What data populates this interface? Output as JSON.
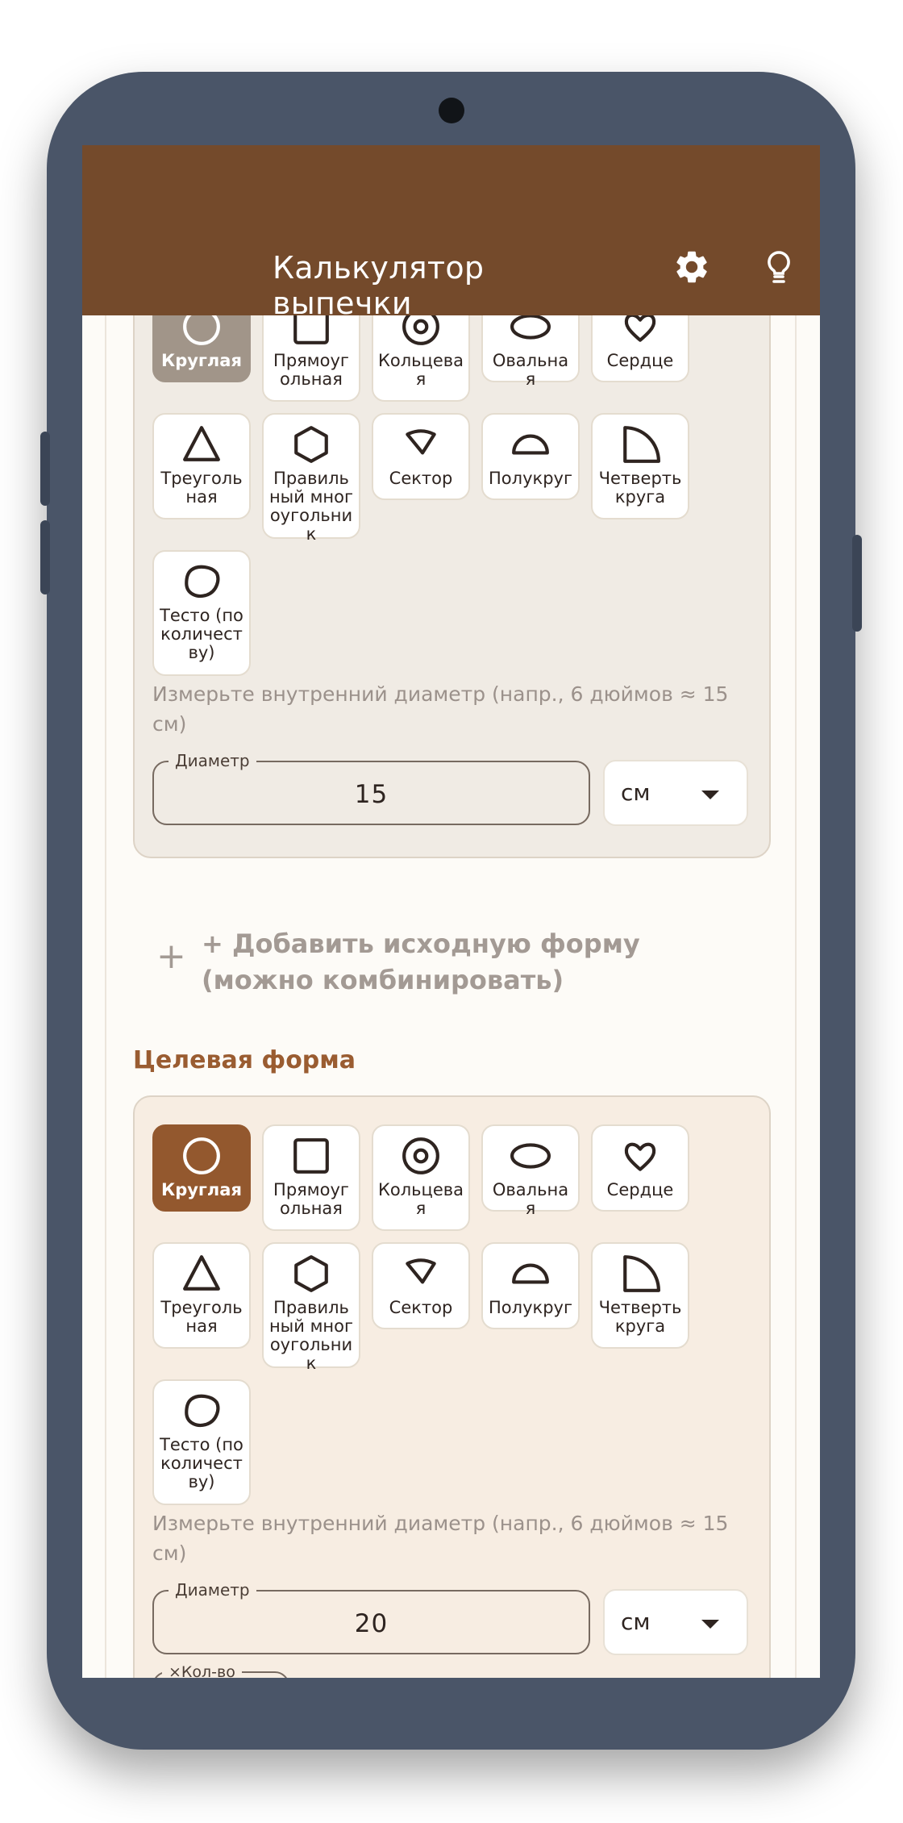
{
  "app": {
    "title": "Калькулятор выпечки",
    "bar_color": "#744a2b",
    "icons": [
      "gear-icon",
      "lightbulb-icon"
    ]
  },
  "source_form": {
    "shapes": [
      {
        "label": "Круглая",
        "icon": "circle-icon",
        "selected": true
      },
      {
        "label": "Прямоугольная",
        "icon": "square-icon"
      },
      {
        "label": "Кольцевая",
        "icon": "ring-icon"
      },
      {
        "label": "Овальная",
        "icon": "oval-icon"
      },
      {
        "label": "Сердце",
        "icon": "heart-icon"
      },
      {
        "label": "Треугольная",
        "icon": "triangle-icon"
      },
      {
        "label": "Правильный многоугольник",
        "icon": "hexagon-icon"
      },
      {
        "label": "Сектор",
        "icon": "sector-icon"
      },
      {
        "label": "Полукруг",
        "icon": "semicircle-icon"
      },
      {
        "label": "Четверть круга",
        "icon": "quarter-circle-icon"
      },
      {
        "label": "Тесто (по количеству)",
        "icon": "dough-blob-icon"
      }
    ],
    "hint": "Измерьте внутренний диаметр (напр., 6 дюймов ≈ 15 см)",
    "field_label": "Диаметр",
    "field_value": "15",
    "unit": "см"
  },
  "add_source": "+ Добавить исходную форму (можно комбинировать)",
  "target_title": "Целевая форма",
  "target_form": {
    "shapes": [
      {
        "label": "Круглая",
        "icon": "circle-icon",
        "selected": true
      },
      {
        "label": "Прямоугольная",
        "icon": "square-icon"
      },
      {
        "label": "Кольцевая",
        "icon": "ring-icon"
      },
      {
        "label": "Овальная",
        "icon": "oval-icon"
      },
      {
        "label": "Сердце",
        "icon": "heart-icon"
      },
      {
        "label": "Треугольная",
        "icon": "triangle-icon"
      },
      {
        "label": "Правильный многоугольник",
        "icon": "hexagon-icon"
      },
      {
        "label": "Сектор",
        "icon": "sector-icon"
      },
      {
        "label": "Полукруг",
        "icon": "semicircle-icon"
      },
      {
        "label": "Четверть круга",
        "icon": "quarter-circle-icon"
      },
      {
        "label": "Тесто (по количеству)",
        "icon": "dough-blob-icon"
      }
    ],
    "hint": "Измерьте внутренний диаметр (напр., 6 дюймов ≈ 15 см)",
    "field_label": "Диаметр",
    "field_value": "20",
    "unit": "см",
    "qty_label": "×Кол-во"
  }
}
